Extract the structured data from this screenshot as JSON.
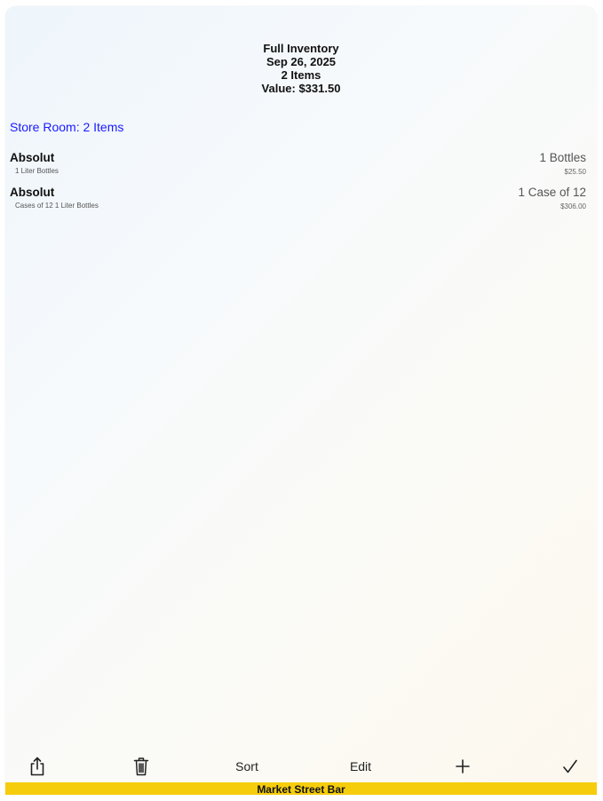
{
  "header": {
    "title": "Full Inventory",
    "date": "Sep 26, 2025",
    "count": "2 Items",
    "value": "Value: $331.50"
  },
  "section": {
    "label": "Store Room:  2 Items"
  },
  "items": [
    {
      "name": "Absolut",
      "description": "1 Liter Bottles",
      "quantity": "1 Bottles",
      "price": "$25.50"
    },
    {
      "name": "Absolut",
      "description": "Cases of 12 1 Liter Bottles",
      "quantity": "1 Case of 12",
      "price": "$306.00"
    }
  ],
  "toolbar": {
    "share_icon": "share-icon",
    "trash_icon": "trash-icon",
    "sort_label": "Sort",
    "edit_label": "Edit",
    "add_icon": "plus-icon",
    "done_icon": "checkmark-icon"
  },
  "footer": {
    "location": "Market Street Bar",
    "accent_color": "#f5cd0d"
  },
  "colors": {
    "section_link": "#1a1aff"
  }
}
